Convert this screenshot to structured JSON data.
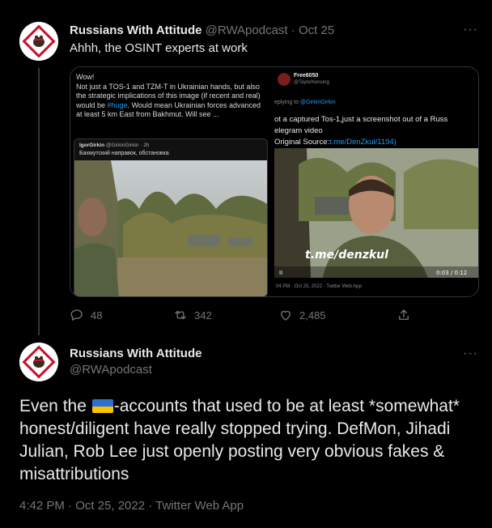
{
  "tweet1": {
    "name": "Russians With Attitude",
    "handle": "@RWApodcast",
    "separator": "·",
    "date": "Oct 25",
    "more": "···",
    "text": "Ahhh, the OSINT experts at work",
    "media_left": {
      "text_pre": "Wow!\nNot just a TOS-1 and TZM-T in Ukrainian hands, but also the strategic implications of this image (if recent and real) would be ",
      "hashtag": "#huge",
      "text_post": ". Would mean Ukrainian forces advanced at least 5 km East from Bakhmut. Will see ...",
      "quote_author": "IgorGirkin",
      "quote_handle": "@GirkinGirkin · 2h",
      "quote_text": "Бахмутский направок, обстановка"
    },
    "media_right": {
      "author": "Free6050",
      "handle": "@TaylorKensing",
      "reply_prefix": "eplying to ",
      "reply_to": "@GirkinGirkin",
      "line1": "ot a captured Tos-1,just a screenshot out of a Russ",
      "line2": "elegram video",
      "source_label": "Original Source:",
      "source_link": "t.me/DenZkul/1194)",
      "watermark": "t.me/denzkul",
      "video_time": "0:03 / 0:12",
      "footer": "04 PM · Oct 25, 2022 · Twitter Web App"
    },
    "actions": {
      "replies": "48",
      "retweets": "342",
      "likes": "2,485"
    }
  },
  "tweet2": {
    "name": "Russians With Attitude",
    "handle": "@RWApodcast",
    "more": "···",
    "body_pre": "Even the ",
    "flag_name": "ukraine-flag",
    "flag_colors": [
      "#2f6fd0",
      "#f6c500"
    ],
    "body_post": "-accounts that used to be at least *somewhat* honest/diligent have really stopped trying. DefMon, Jihadi Julian, Rob Lee just openly posting very obvious fakes & misattributions",
    "meta": "4:42 PM · Oct 25, 2022 · Twitter Web App"
  },
  "colors": {
    "background": "#000000",
    "text": "#e7e9ea",
    "muted": "#71767b",
    "link": "#1d9bf0"
  }
}
